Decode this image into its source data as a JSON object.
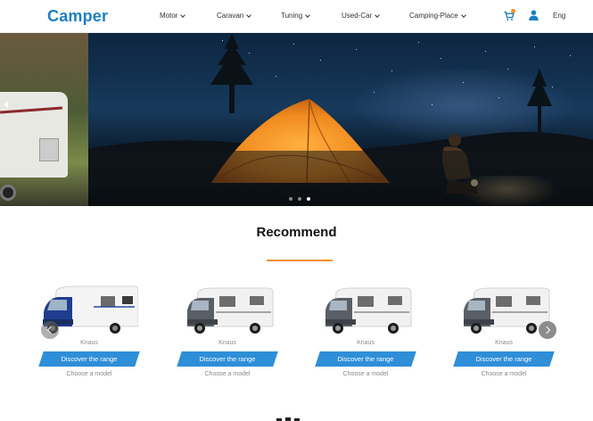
{
  "header": {
    "logo": "Camper",
    "nav": [
      {
        "label": "Motor"
      },
      {
        "label": "Caravan"
      },
      {
        "label": "Tuning"
      },
      {
        "label": "Used-Car"
      },
      {
        "label": "Camping-Place"
      }
    ],
    "lang": "Eng",
    "icons": {
      "cart": "cart-icon",
      "user": "user-icon"
    },
    "colors": {
      "brand": "#1d7fc3",
      "accent": "#f2902a"
    }
  },
  "hero": {
    "slides_count": 3,
    "active_slide": 3
  },
  "recommend": {
    "title": "Recommend",
    "cards": [
      {
        "brand": "Knaus",
        "button": "Discover the range",
        "link": "Choose a model"
      },
      {
        "brand": "Knaus",
        "button": "Discover the range",
        "link": "Choose a model"
      },
      {
        "brand": "Knaus",
        "button": "Discover the range",
        "link": "Choose a model"
      },
      {
        "brand": "Knaus",
        "button": "Discover the range",
        "link": "Choose a model"
      }
    ],
    "button_color": "#2f8ed8"
  }
}
